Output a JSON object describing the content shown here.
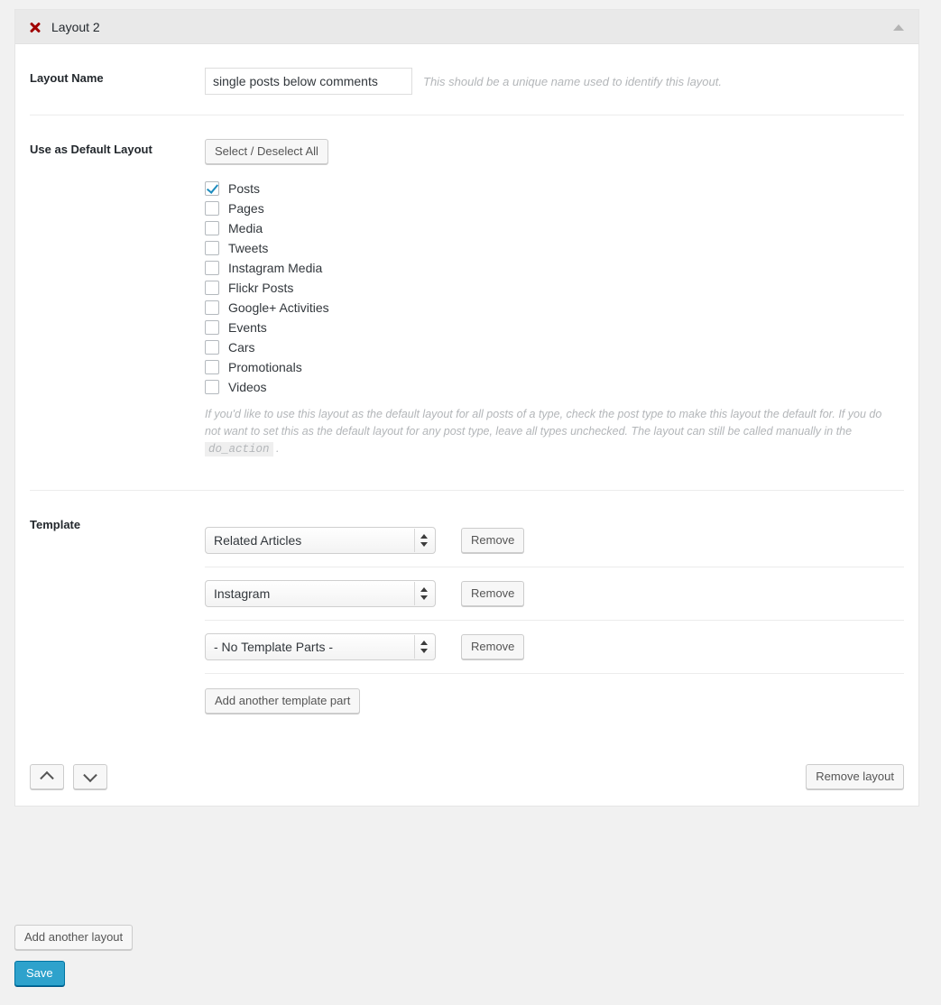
{
  "panel": {
    "title": "Layout 2",
    "close_icon": "x-icon",
    "toggle_icon": "triangle-up-icon"
  },
  "layout_name": {
    "label": "Layout Name",
    "value": "single posts below comments",
    "placeholder": "",
    "help": "This should be a unique name used to identify this layout."
  },
  "default_layout": {
    "label": "Use as Default Layout",
    "select_all_label": "Select / Deselect All",
    "post_types": [
      {
        "label": "Posts",
        "checked": true
      },
      {
        "label": "Pages",
        "checked": false
      },
      {
        "label": "Media",
        "checked": false
      },
      {
        "label": "Tweets",
        "checked": false
      },
      {
        "label": "Instagram Media",
        "checked": false
      },
      {
        "label": "Flickr Posts",
        "checked": false
      },
      {
        "label": "Google+ Activities",
        "checked": false
      },
      {
        "label": "Events",
        "checked": false
      },
      {
        "label": "Cars",
        "checked": false
      },
      {
        "label": "Promotionals",
        "checked": false
      },
      {
        "label": "Videos",
        "checked": false
      }
    ],
    "note_before": "If you'd like to use this layout as the default layout for all posts of a type, check the post type to make this layout the default for. If you do not want to set this as the default layout for any post type, leave all types unchecked. The layout can still be called manually in the ",
    "note_code": "do_action",
    "note_after": " ."
  },
  "template": {
    "label": "Template",
    "parts": [
      {
        "value": "Related Articles",
        "remove_label": "Remove"
      },
      {
        "value": "Instagram",
        "remove_label": "Remove"
      },
      {
        "value": "- No Template Parts -",
        "remove_label": "Remove"
      }
    ],
    "add_part_label": "Add another template part"
  },
  "panel_footer": {
    "move_up_icon": "chevron-up-icon",
    "move_down_icon": "chevron-down-icon",
    "remove_layout_label": "Remove layout"
  },
  "outer": {
    "add_layout_label": "Add another layout",
    "save_label": "Save"
  },
  "colors": {
    "primary": "#2ea2cc",
    "close_icon": "#a00000",
    "checkbox_check": "#1e8cbe",
    "page_background": "#f1f1f1",
    "panel_header": "#e9e9e9"
  }
}
